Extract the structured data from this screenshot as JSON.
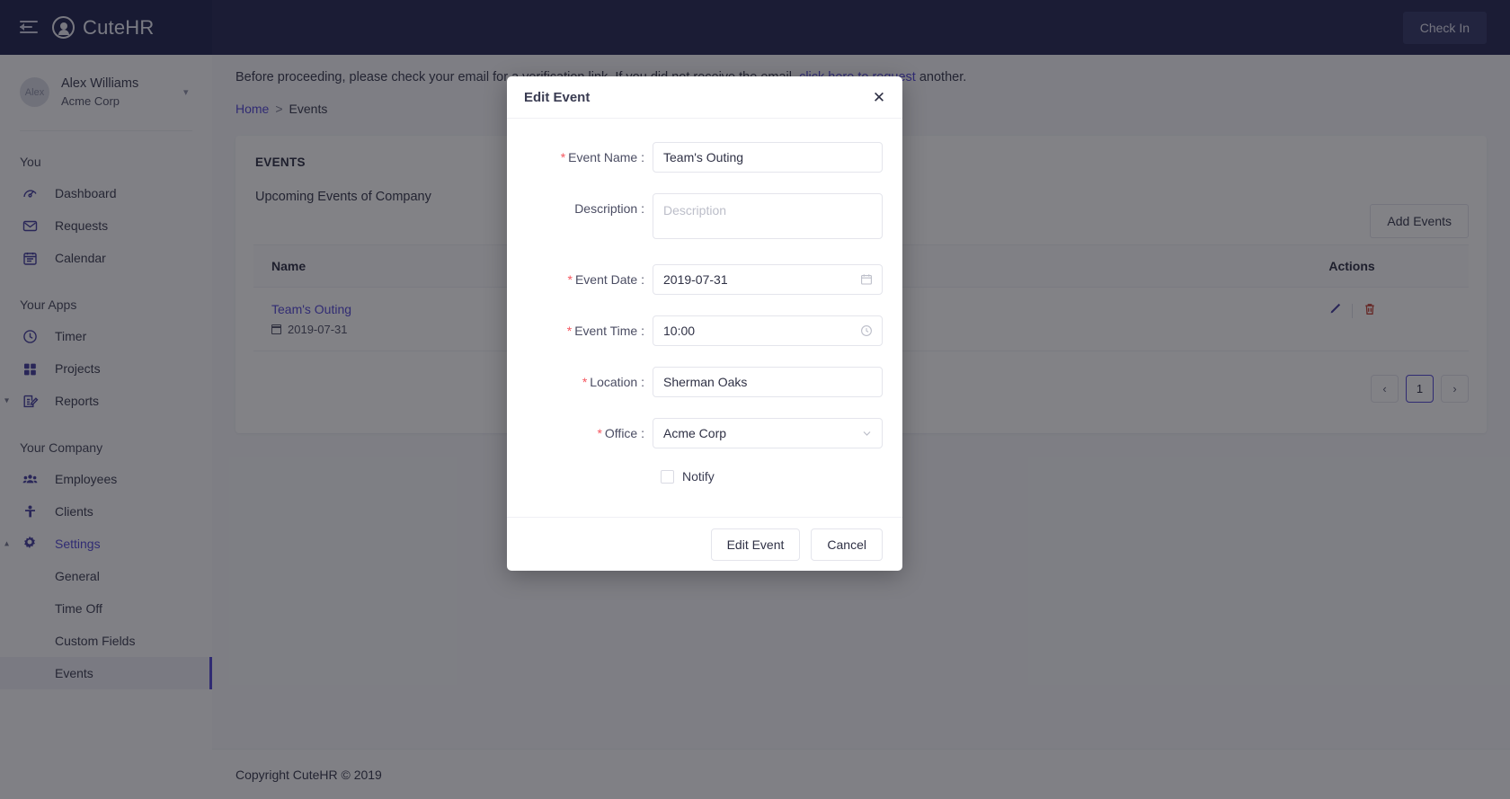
{
  "topbar": {
    "menu_icon": "hamburger-collapse-icon",
    "brand": "CuteHR",
    "checkin_label": "Check In"
  },
  "sidebar": {
    "profile": {
      "avatar_initials": "Alex",
      "name": "Alex Williams",
      "org": "Acme Corp"
    },
    "groups": [
      {
        "title": "You",
        "items": [
          {
            "label": "Dashboard",
            "icon": "dashboard-gauge-icon"
          },
          {
            "label": "Requests",
            "icon": "envelope-icon"
          },
          {
            "label": "Calendar",
            "icon": "calendar-icon"
          }
        ]
      },
      {
        "title": "Your Apps",
        "items": [
          {
            "label": "Timer",
            "icon": "clock-icon"
          },
          {
            "label": "Projects",
            "icon": "grid-squares-icon"
          },
          {
            "label": "Reports",
            "icon": "report-edit-icon"
          }
        ]
      },
      {
        "title": "Your Company",
        "items": [
          {
            "label": "Employees",
            "icon": "people-group-icon"
          },
          {
            "label": "Clients",
            "icon": "person-icon"
          },
          {
            "label": "Settings",
            "icon": "gear-icon"
          },
          {
            "label": "General",
            "icon": ""
          },
          {
            "label": "Time Off",
            "icon": ""
          },
          {
            "label": "Custom Fields",
            "icon": ""
          },
          {
            "label": "Events",
            "icon": ""
          }
        ]
      }
    ]
  },
  "notice": {
    "text_before": "Before proceeding, please check your email for a verification link. If you did not receive the email, ",
    "link": "click here to request",
    "text_after": " another."
  },
  "breadcrumb": {
    "home": "Home",
    "separator": ">",
    "current": "Events"
  },
  "events_card": {
    "title": "EVENTS",
    "subtitle": "Upcoming Events of Company",
    "add_button": "Add Events",
    "columns": [
      "Name",
      "Actions"
    ],
    "rows": [
      {
        "name": "Team's Outing",
        "date": "2019-07-31",
        "edit_icon": "pencil-icon",
        "delete_icon": "trash-icon"
      }
    ],
    "pagination": {
      "prev": "‹",
      "current_page": "1",
      "next": "›"
    }
  },
  "footer": {
    "copyright": "Copyright CuteHR © 2019"
  },
  "modal": {
    "title": "Edit Event",
    "close_icon": "close-icon",
    "fields": [
      {
        "label": "Event Name",
        "required": true,
        "value": "Team's Outing",
        "placeholder": "",
        "type": "text"
      },
      {
        "label": "Description",
        "required": false,
        "value": "",
        "placeholder": "Description",
        "type": "textarea"
      },
      {
        "label": "Event Date",
        "required": true,
        "value": "2019-07-31",
        "placeholder": "",
        "type": "date",
        "icon": "calendar-icon"
      },
      {
        "label": "Event Time",
        "required": true,
        "value": "10:00",
        "placeholder": "",
        "type": "time",
        "icon": "clock-icon"
      },
      {
        "label": "Location",
        "required": true,
        "value": "Sherman Oaks",
        "placeholder": "",
        "type": "text"
      },
      {
        "label": "Office",
        "required": true,
        "value": "Acme Corp",
        "placeholder": "",
        "type": "select",
        "icon": "chevron-down-icon"
      }
    ],
    "checkbox": {
      "label": "Notify",
      "checked": false
    },
    "primary_button": "Edit Event",
    "secondary_button": "Cancel"
  },
  "colors": {
    "brand_dark": "#141a47",
    "topbar": "#1b1d4d",
    "accent": "#4b3fd4",
    "required": "#f5565f",
    "delete": "#c0392b"
  }
}
